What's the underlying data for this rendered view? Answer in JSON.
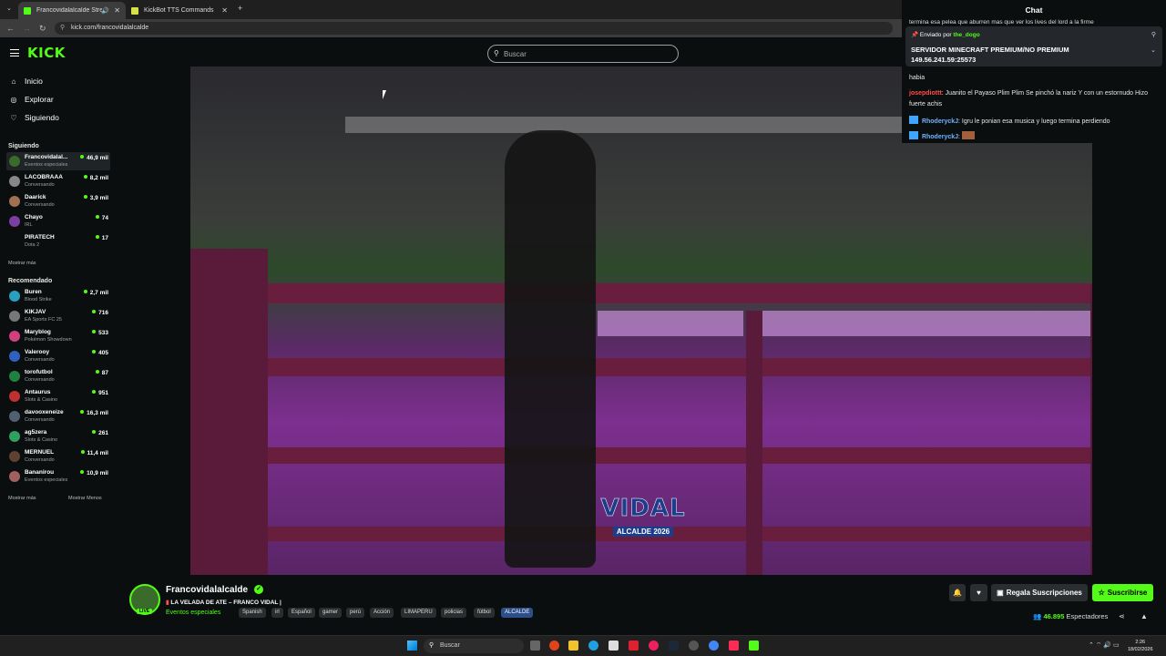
{
  "browser": {
    "tabs": [
      {
        "label": "Francovidalalcalde Stream",
        "active": true
      },
      {
        "label": "KickBot TTS Commands",
        "active": false
      }
    ],
    "new_tab": "+",
    "url": "kick.com/francovidalalcalde"
  },
  "header": {
    "logo": "KICK",
    "search_placeholder": "Buscar"
  },
  "sidebar": {
    "nav": [
      {
        "label": "Inicio",
        "icon": "home-icon"
      },
      {
        "label": "Explorar",
        "icon": "compass-icon"
      },
      {
        "label": "Siguiendo",
        "icon": "heart-icon"
      }
    ],
    "following_title": "Siguiendo",
    "following": [
      {
        "name": "Francovidalal...",
        "category": "Eventos especiales",
        "viewers": "46,9 mil",
        "color": "#3a6b2a"
      },
      {
        "name": "LACOBRAAA",
        "category": "Conversando",
        "viewers": "8,2 mil",
        "color": "#888888"
      },
      {
        "name": "Daarick",
        "category": "Conversando",
        "viewers": "3,9 mil",
        "color": "#a07050"
      },
      {
        "name": "Chayo",
        "category": "IRL",
        "viewers": "74",
        "color": "#7a3fa0"
      },
      {
        "name": "PIRATECH",
        "category": "Dota 2",
        "viewers": "17",
        "color": "#0b0e0f"
      }
    ],
    "following_more": "Mostrar más",
    "recommended_title": "Recomendado",
    "recommended": [
      {
        "name": "Buren",
        "category": "Blood Strike",
        "viewers": "2,7 mil",
        "color": "#2aa0c0"
      },
      {
        "name": "KIKJAV",
        "category": "EA Sports FC 25",
        "viewers": "716",
        "color": "#777777"
      },
      {
        "name": "Maryblog",
        "category": "Pokémon Showdown",
        "viewers": "533",
        "color": "#d04080"
      },
      {
        "name": "Valerooy",
        "category": "Conversando",
        "viewers": "405",
        "color": "#3060c0"
      },
      {
        "name": "torofutbol",
        "category": "Conversando",
        "viewers": "87",
        "color": "#208040"
      },
      {
        "name": "Antaurus",
        "category": "Slots & Casino",
        "viewers": "951",
        "color": "#c03030"
      },
      {
        "name": "davooxeneize",
        "category": "Conversando",
        "viewers": "16,3 mil",
        "color": "#506070"
      },
      {
        "name": "ag5zera",
        "category": "Slots & Casino",
        "viewers": "261",
        "color": "#30a060"
      },
      {
        "name": "MERNUEL",
        "category": "Conversando",
        "viewers": "11,4 mil",
        "color": "#604030"
      },
      {
        "name": "Bananirou",
        "category": "Eventos especiales",
        "viewers": "10,9 mil",
        "color": "#a06060"
      }
    ],
    "rec_more": "Mostrar más",
    "rec_less": "Mostrar Menos"
  },
  "video": {
    "watermark_big": "VIDAL",
    "watermark_small": "ALCALDE 2026"
  },
  "chat": {
    "title": "Chat",
    "peek": "termina esa pelea que aburren mas que ver los lives del lord a la firme",
    "pinned_by_label": "Enviado por",
    "pinned_user": "the_dogo",
    "pinned_message": "SERVIDOR MINECRAFT PREMIUM/NO PREMIUM 149.56.241.59:25573",
    "messages": [
      {
        "user": "",
        "text": "habia",
        "color": "#ffffff"
      },
      {
        "user": "josepdiottt",
        "text": "Juanito el Payaso Plim Plim Se pinchó la nariz Y con un estornudo Hizo fuerte achis",
        "color": "#ff4d4d"
      },
      {
        "user": "RhoderyckJ",
        "text": "Igru le ponian esa musica y luego termina perdiendo",
        "color": "#6fb4ff"
      },
      {
        "user": "RhoderyckJ",
        "text": "",
        "color": "#6fb4ff"
      }
    ]
  },
  "stream": {
    "channel": "Francovidalalcalde",
    "live_label": "LIVE",
    "title": "LA VELADA DE ATE – FRANCO VIDAL |",
    "category": "Eventos especiales",
    "tags": [
      "Spanish",
      "irl",
      "Español",
      "gamer",
      "perú",
      "Acción",
      "LIMAPERU",
      "policias",
      "fútbol",
      "ALCALDE"
    ],
    "gift_label": "Regala Suscripciones",
    "subscribe_label": "Suscribirse",
    "viewers": "46.895",
    "viewers_label": "Espectadores"
  },
  "taskbar": {
    "search_placeholder": "Buscar",
    "time": "2:26",
    "date": "18/02/2026"
  }
}
